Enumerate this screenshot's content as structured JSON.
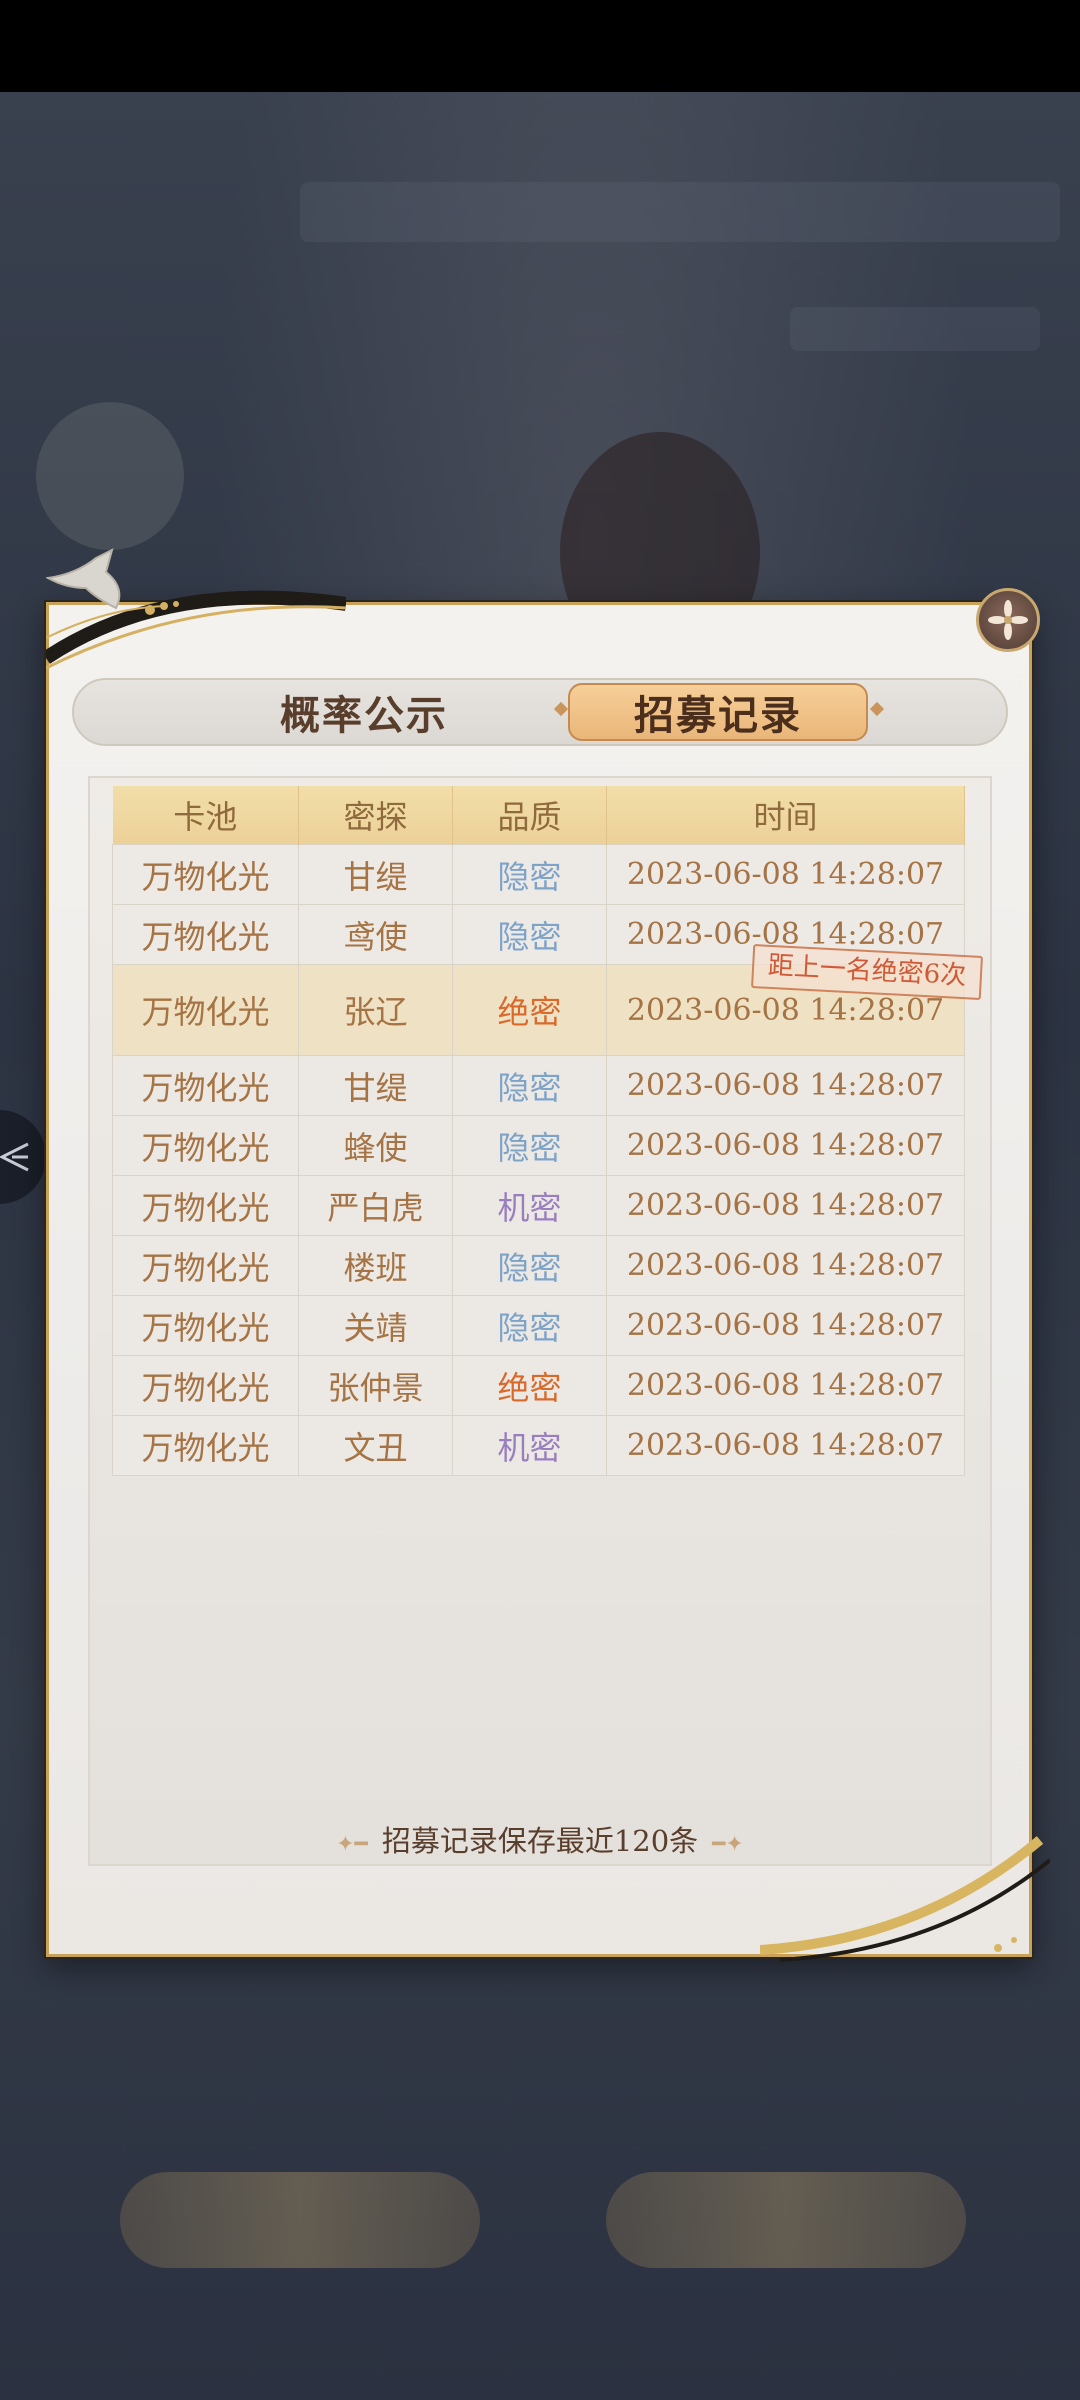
{
  "tabs": {
    "probability": "概率公示",
    "records": "招募记录"
  },
  "table": {
    "headers": [
      "卡池",
      "密探",
      "品质",
      "时间"
    ],
    "rows": [
      {
        "pool": "万物化光",
        "agent": "甘缇",
        "quality": "隐密",
        "quality_color": "#7ea3c9",
        "time": "2023-06-08 14:28:07"
      },
      {
        "pool": "万物化光",
        "agent": "鸢使",
        "quality": "隐密",
        "quality_color": "#7ea3c9",
        "time": "2023-06-08 14:28:07"
      },
      {
        "pool": "万物化光",
        "agent": "张辽",
        "quality": "绝密",
        "quality_color": "#d96a2c",
        "time": "2023-06-08 14:28:07",
        "highlight": true
      },
      {
        "pool": "万物化光",
        "agent": "甘缇",
        "quality": "隐密",
        "quality_color": "#7ea3c9",
        "time": "2023-06-08 14:28:07"
      },
      {
        "pool": "万物化光",
        "agent": "蜂使",
        "quality": "隐密",
        "quality_color": "#7ea3c9",
        "time": "2023-06-08 14:28:07"
      },
      {
        "pool": "万物化光",
        "agent": "严白虎",
        "quality": "机密",
        "quality_color": "#9a7fbf",
        "time": "2023-06-08 14:28:07"
      },
      {
        "pool": "万物化光",
        "agent": "楼班",
        "quality": "隐密",
        "quality_color": "#7ea3c9",
        "time": "2023-06-08 14:28:07"
      },
      {
        "pool": "万物化光",
        "agent": "关靖",
        "quality": "隐密",
        "quality_color": "#7ea3c9",
        "time": "2023-06-08 14:28:07"
      },
      {
        "pool": "万物化光",
        "agent": "张仲景",
        "quality": "绝密",
        "quality_color": "#d96a2c",
        "time": "2023-06-08 14:28:07"
      },
      {
        "pool": "万物化光",
        "agent": "文丑",
        "quality": "机密",
        "quality_color": "#9a7fbf",
        "time": "2023-06-08 14:28:07"
      }
    ]
  },
  "stamp": "距上一名绝密6次",
  "footer": "招募记录保存最近120条",
  "icons": {
    "close": "flower-close-icon",
    "left": "left-arrow-icon"
  }
}
